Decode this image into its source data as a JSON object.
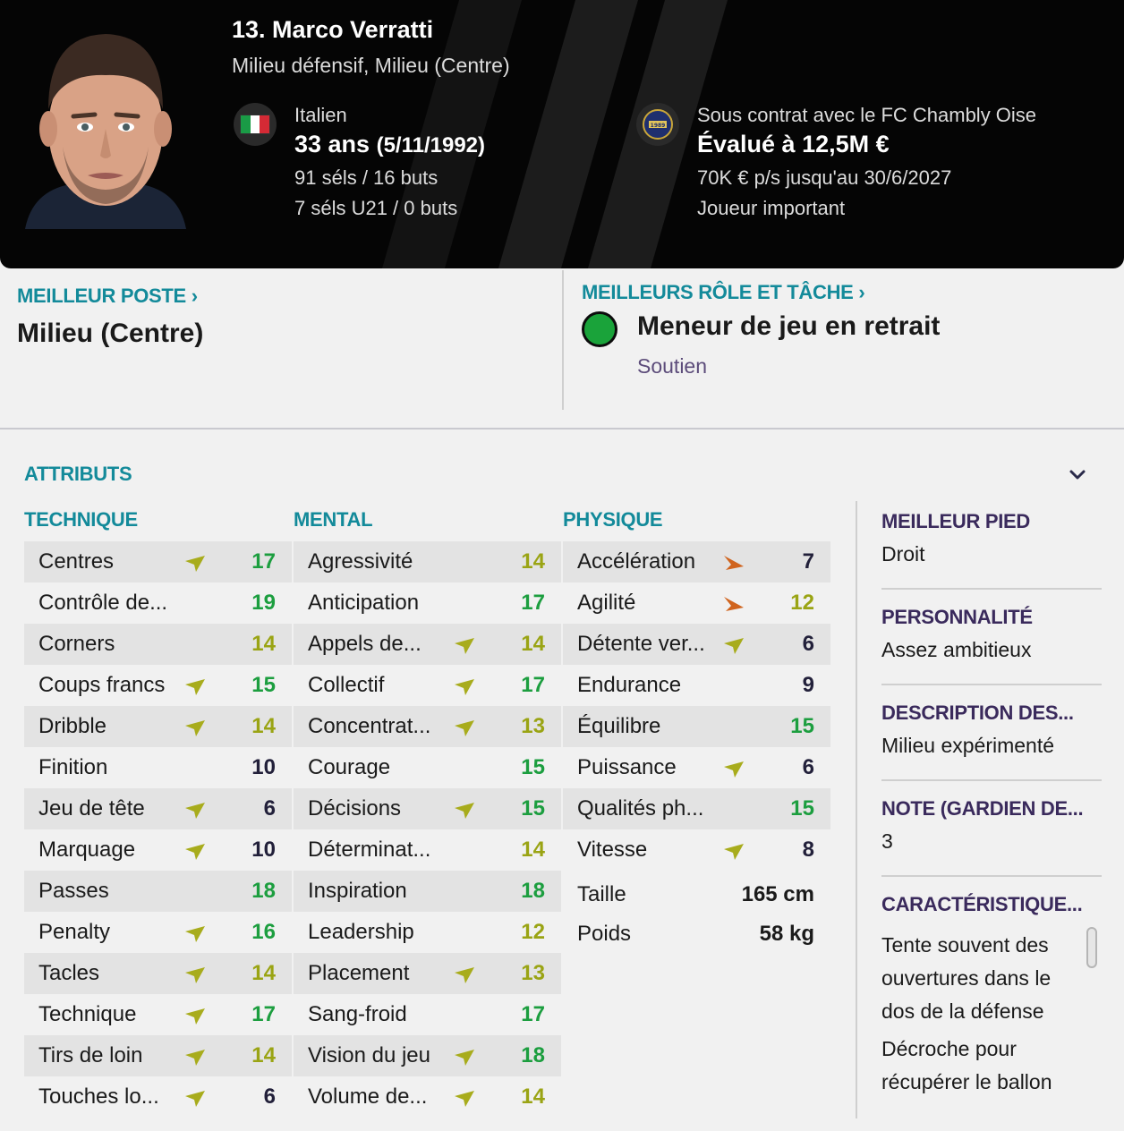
{
  "player": {
    "name": "13. Marco Verratti",
    "positions": "Milieu défensif, Milieu (Centre)",
    "nationality": "Italien",
    "age": "33 ans",
    "dob": "(5/11/1992)",
    "caps": "91 séls / 16 buts",
    "u21_caps": "7 séls U21 / 0 buts",
    "contract": "Sous contrat avec le FC Chambly Oise",
    "value": "Évalué à 12,5M €",
    "wage": "70K € p/s jusqu'au 30/6/2027",
    "status": "Joueur important"
  },
  "best_position": {
    "title": "MEILLEUR POSTE",
    "value": "Milieu (Centre)"
  },
  "best_role": {
    "title": "MEILLEURS RÔLE ET TÂCHE",
    "role": "Meneur de jeu en retrait",
    "duty": "Soutien"
  },
  "attributes": {
    "title": "ATTRIBUTS",
    "technical": {
      "title": "TECHNIQUE",
      "rows": [
        {
          "name": "Centres",
          "value": "17",
          "arrow": "up"
        },
        {
          "name": "Contrôle de...",
          "value": "19",
          "arrow": ""
        },
        {
          "name": "Corners",
          "value": "14",
          "arrow": ""
        },
        {
          "name": "Coups francs",
          "value": "15",
          "arrow": "up"
        },
        {
          "name": "Dribble",
          "value": "14",
          "arrow": "up"
        },
        {
          "name": "Finition",
          "value": "10",
          "arrow": ""
        },
        {
          "name": "Jeu de tête",
          "value": "6",
          "arrow": "up"
        },
        {
          "name": "Marquage",
          "value": "10",
          "arrow": "up"
        },
        {
          "name": "Passes",
          "value": "18",
          "arrow": ""
        },
        {
          "name": "Penalty",
          "value": "16",
          "arrow": "up"
        },
        {
          "name": "Tacles",
          "value": "14",
          "arrow": "up"
        },
        {
          "name": "Technique",
          "value": "17",
          "arrow": "up"
        },
        {
          "name": "Tirs de loin",
          "value": "14",
          "arrow": "up"
        },
        {
          "name": "Touches lo...",
          "value": "6",
          "arrow": "up"
        }
      ]
    },
    "mental": {
      "title": "MENTAL",
      "rows": [
        {
          "name": "Agressivité",
          "value": "14",
          "arrow": ""
        },
        {
          "name": "Anticipation",
          "value": "17",
          "arrow": ""
        },
        {
          "name": "Appels de...",
          "value": "14",
          "arrow": "up"
        },
        {
          "name": "Collectif",
          "value": "17",
          "arrow": "up"
        },
        {
          "name": "Concentrat...",
          "value": "13",
          "arrow": "up"
        },
        {
          "name": "Courage",
          "value": "15",
          "arrow": ""
        },
        {
          "name": "Décisions",
          "value": "15",
          "arrow": "up"
        },
        {
          "name": "Déterminat...",
          "value": "14",
          "arrow": ""
        },
        {
          "name": "Inspiration",
          "value": "18",
          "arrow": ""
        },
        {
          "name": "Leadership",
          "value": "12",
          "arrow": ""
        },
        {
          "name": "Placement",
          "value": "13",
          "arrow": "up"
        },
        {
          "name": "Sang-froid",
          "value": "17",
          "arrow": ""
        },
        {
          "name": "Vision du jeu",
          "value": "18",
          "arrow": "up"
        },
        {
          "name": "Volume de...",
          "value": "14",
          "arrow": "up"
        }
      ]
    },
    "physical": {
      "title": "PHYSIQUE",
      "rows": [
        {
          "name": "Accélération",
          "value": "7",
          "arrow": "down"
        },
        {
          "name": "Agilité",
          "value": "12",
          "arrow": "down"
        },
        {
          "name": "Détente ver...",
          "value": "6",
          "arrow": "up"
        },
        {
          "name": "Endurance",
          "value": "9",
          "arrow": ""
        },
        {
          "name": "Équilibre",
          "value": "15",
          "arrow": ""
        },
        {
          "name": "Puissance",
          "value": "6",
          "arrow": "up"
        },
        {
          "name": "Qualités ph...",
          "value": "15",
          "arrow": ""
        },
        {
          "name": "Vitesse",
          "value": "8",
          "arrow": "up"
        }
      ],
      "height_label": "Taille",
      "height": "165 cm",
      "weight_label": "Poids",
      "weight": "58 kg"
    }
  },
  "side": {
    "foot_title": "MEILLEUR PIED",
    "foot": "Droit",
    "personality_title": "PERSONNALITÉ",
    "personality": "Assez ambitieux",
    "desc_title": "DESCRIPTION DES...",
    "desc": "Milieu expérimenté",
    "gk_title": "NOTE (GARDIEN DE...",
    "gk": "3",
    "traits_title": "CARACTÉRISTIQUE...",
    "traits": [
      "Tente souvent des ouvertures dans le dos de la défense",
      "Décroche pour récupérer le ballon"
    ]
  },
  "colors": {
    "green": "#1c9e3f",
    "olive": "#9aa414",
    "dark": "#22203a",
    "teal": "#138a9a",
    "purple": "#3a2a5c",
    "arrow_up": "#a8ac1c",
    "arrow_down": "#d0641e"
  }
}
